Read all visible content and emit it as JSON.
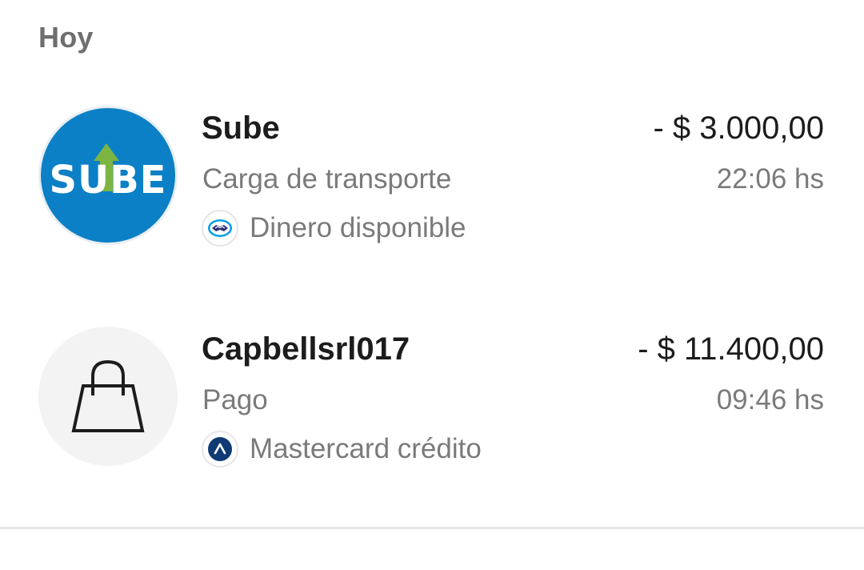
{
  "section": {
    "title": "Hoy"
  },
  "transactions": [
    {
      "merchant": "Sube",
      "description": "Carga de transporte",
      "amount": "- $ 3.000,00",
      "time": "22:06 hs",
      "method": "Dinero disponible",
      "avatar_icon": "sube-logo-icon",
      "method_icon": "mercadopago-handshake-icon",
      "logo_text": "SUBE"
    },
    {
      "merchant": "Capbellsrl017",
      "description": "Pago",
      "amount": "- $ 11.400,00",
      "time": "09:46 hs",
      "method": "Mastercard crédito",
      "avatar_icon": "shopping-bag-icon",
      "method_icon": "credit-card-chevron-icon"
    }
  ],
  "colors": {
    "sube_blue": "#0b80c6",
    "sube_green": "#7db542",
    "text_primary": "#1c1c1c",
    "text_secondary": "#7a7a7a",
    "mp_blue": "#009ee3",
    "card_navy": "#0f3a73"
  }
}
